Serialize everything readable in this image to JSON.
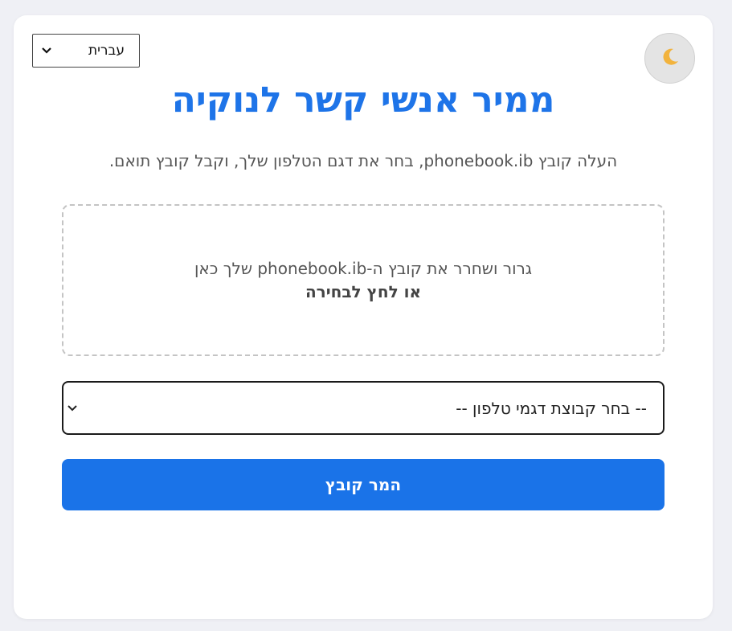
{
  "theme_toggle": {
    "icon": "moon-icon",
    "glyph": "🌙"
  },
  "language_select": {
    "selected": "עברית",
    "icon": "chevron-down-icon"
  },
  "header": {
    "title": "ממיר אנשי קשר לנוקיה",
    "subtitle": "העלה קובץ phonebook.ib, בחר את דגם הטלפון שלך, וקבל קובץ תואם."
  },
  "dropzone": {
    "text": "גרור ושחרר את קובץ ה-phonebook.ib שלך כאן",
    "cta": "או לחץ לבחירה"
  },
  "model_select": {
    "selected": "-- בחר קבוצת דגמי טלפון --",
    "icon": "chevron-down-icon"
  },
  "convert_button": {
    "label": "המר קובץ"
  },
  "colors": {
    "accent": "#1a73e8",
    "title": "#1e74e8",
    "background": "#eff0f5"
  }
}
